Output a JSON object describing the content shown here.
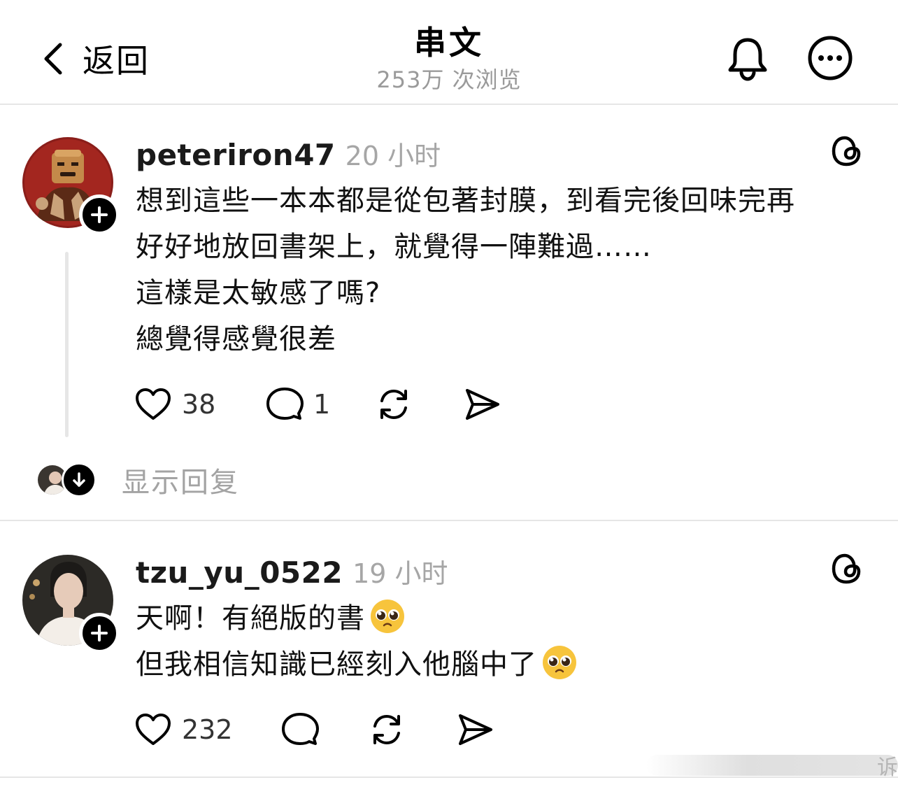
{
  "header": {
    "back_label": "返回",
    "title": "串文",
    "views": "253万 次浏览",
    "icons": [
      "chevron-left-icon",
      "bell-icon",
      "more-icon"
    ]
  },
  "posts": [
    {
      "username": "peteriron47",
      "time": "20 小时",
      "lines": [
        "想到這些一本本都是從包著封膜，到看完後回味完再",
        "好好地放回書架上，就覺得一陣難過……",
        "這樣是太敏感了嗎?",
        "總覺得感覺很差"
      ],
      "likes": "38",
      "comments": "1",
      "show_replies": "显示回复"
    },
    {
      "username": "tzu_yu_0522",
      "time": "19 小时",
      "lines": [
        "天啊！有絕版的書",
        "但我相信知識已經刻入他腦中了"
      ],
      "likes": "232",
      "comments": ""
    }
  ],
  "watermark": "诉",
  "colors": {
    "text": "#111111",
    "muted": "#a6a6a6",
    "divider": "#e6e6e6"
  }
}
